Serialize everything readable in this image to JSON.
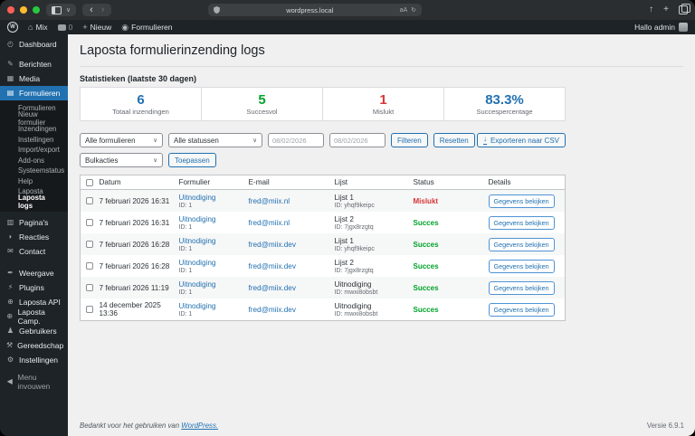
{
  "colors": {
    "accent": "#2271b1",
    "success": "#00a32a",
    "error": "#d63638"
  },
  "browser": {
    "url": "wordpress.local",
    "back": "‹",
    "forward": "›",
    "chevron_down": "∨",
    "translate_glyph": "aA",
    "reload_glyph": "↻",
    "share_glyph": "↑",
    "new_tab_glyph": "+"
  },
  "admin_bar": {
    "wp_logo": "W",
    "home_glyph": "⌂",
    "site_name": "Mix",
    "comment_count": "0",
    "plus_glyph": "+",
    "new_label": "Nieuw",
    "form_glyph": "◉",
    "form_label": "Formulieren",
    "greeting": "Hallo admin"
  },
  "sidebar": {
    "items_top": [
      {
        "icon": "dashboard-icon",
        "glyph": "◴",
        "label": "Dashboard"
      },
      {
        "icon": "posts-icon",
        "glyph": "✎",
        "label": "Berichten"
      },
      {
        "icon": "media-icon",
        "glyph": "▦",
        "label": "Media"
      }
    ],
    "active": {
      "icon": "forms-icon",
      "glyph": "▤",
      "label": "Formulieren"
    },
    "submenu": [
      "Formulieren",
      "Nieuw formulier",
      "Inzendingen",
      "Instellingen",
      "Import/export",
      "Add-ons",
      "Systeemstatus",
      "Help",
      "Laposta",
      "Laposta logs"
    ],
    "submenu_current": "Laposta logs",
    "items_middle": [
      {
        "icon": "pages-icon",
        "glyph": "▥",
        "label": "Pagina's"
      },
      {
        "icon": "comments-icon",
        "glyph": "◗",
        "label": "Reacties"
      },
      {
        "icon": "contact-icon",
        "glyph": "✉",
        "label": "Contact"
      }
    ],
    "items_lower": [
      {
        "icon": "appearance-icon",
        "glyph": "✒",
        "label": "Weergave"
      },
      {
        "icon": "plugins-icon",
        "glyph": "⚡",
        "label": "Plugins"
      },
      {
        "icon": "laposta-api-icon",
        "glyph": "⊕",
        "label": "Laposta API"
      },
      {
        "icon": "laposta-camp-icon",
        "glyph": "⊕",
        "label": "Laposta Camp."
      },
      {
        "icon": "users-icon",
        "glyph": "♟",
        "label": "Gebruikers"
      },
      {
        "icon": "tools-icon",
        "glyph": "⚒",
        "label": "Gereedschap"
      },
      {
        "icon": "settings-icon",
        "glyph": "⚙",
        "label": "Instellingen"
      }
    ],
    "collapse": {
      "icon": "collapse-icon",
      "glyph": "◀",
      "label": "Menu invouwen"
    }
  },
  "page": {
    "title": "Laposta formulierinzending logs",
    "stats_heading": "Statistieken (laatste 30 dagen)"
  },
  "stats": [
    {
      "value": "6",
      "label": "Totaal inzendingen",
      "color": "#2271b1"
    },
    {
      "value": "5",
      "label": "Succesvol",
      "color": "#00a32a"
    },
    {
      "value": "1",
      "label": "Mislukt",
      "color": "#d63638"
    },
    {
      "value": "83.3%",
      "label": "Succespercentage",
      "color": "#2271b1"
    }
  ],
  "filters": {
    "form_select": "Alle formulieren",
    "status_select": "Alle statussen",
    "date_from_placeholder": "08/02/2026",
    "date_to_placeholder": "08/02/2026",
    "filter_button": "Filteren",
    "reset_button": "Resetten",
    "export_button": "Exporteren naar CSV",
    "bulk_select": "Bulkacties",
    "apply_button": "Toepassen"
  },
  "table": {
    "columns": [
      "Datum",
      "Formulier",
      "E-mail",
      "Lijst",
      "Status",
      "Details"
    ],
    "details_button": "Gegevens bekijken",
    "rows": [
      {
        "date": "7 februari 2026 16:31",
        "form": "Uitnodiging",
        "form_id": "ID: 1",
        "email": "fred@miix.nl",
        "list": "Lijst 1",
        "list_id": "ID: yhqf9keipc",
        "status": "Mislukt",
        "status_type": "error"
      },
      {
        "date": "7 februari 2026 16:31",
        "form": "Uitnodiging",
        "form_id": "ID: 1",
        "email": "fred@miix.nl",
        "list": "Lijst 2",
        "list_id": "ID: 7jgx8rzgtq",
        "status": "Succes",
        "status_type": "success"
      },
      {
        "date": "7 februari 2026 16:28",
        "form": "Uitnodiging",
        "form_id": "ID: 1",
        "email": "fred@miix.dev",
        "list": "Lijst 1",
        "list_id": "ID: yhqf9keipc",
        "status": "Succes",
        "status_type": "success"
      },
      {
        "date": "7 februari 2026 16:28",
        "form": "Uitnodiging",
        "form_id": "ID: 1",
        "email": "fred@miix.dev",
        "list": "Lijst 2",
        "list_id": "ID: 7jgx8rzgtq",
        "status": "Succes",
        "status_type": "success"
      },
      {
        "date": "7 februari 2026 11:19",
        "form": "Uitnodiging",
        "form_id": "ID: 1",
        "email": "fred@miix.dev",
        "list": "Uitnodiging",
        "list_id": "ID: mwxi8obsbt",
        "status": "Succes",
        "status_type": "success"
      },
      {
        "date": "14 december 2025 13:36",
        "form": "Uitnodiging",
        "form_id": "ID: 1",
        "email": "fred@miix.dev",
        "list": "Uitnodiging",
        "list_id": "ID: mwxi8obsbt",
        "status": "Succes",
        "status_type": "success"
      }
    ]
  },
  "footer": {
    "thanks": "Bedankt voor het gebruiken van",
    "link": "WordPress.",
    "version": "Versie 6.9.1"
  }
}
